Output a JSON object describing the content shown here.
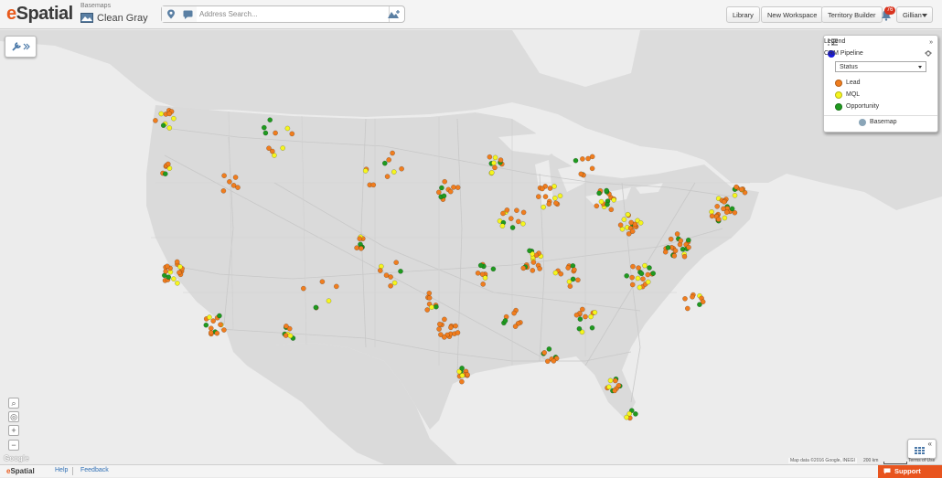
{
  "app": {
    "logo_e": "e",
    "logo_rest": "Spatial"
  },
  "basemap": {
    "caption": "Basemaps",
    "name": "Clean Gray"
  },
  "search": {
    "placeholder": "Address Search..."
  },
  "toolbar": {
    "library": "Library",
    "new_workspace": "New Workspace",
    "territory_builder": "Territory Builder",
    "notifications_count": "76",
    "user": "Gillian"
  },
  "legend": {
    "title": "Legend",
    "layer": "CRM Pipeline",
    "layer_color": "#1a1adb",
    "selected_field": "Status",
    "categories": [
      {
        "label": "Lead",
        "color": "#f07d1e"
      },
      {
        "label": "MQL",
        "color": "#f5f51e"
      },
      {
        "label": "Opportunity",
        "color": "#1f9a1f"
      }
    ],
    "basemap_link": "Basemap"
  },
  "map": {
    "watermark": "Google",
    "attribution": "Map data ©2016 Google, INEGI",
    "scale": "200 km",
    "terms": "Terms of Use"
  },
  "footer": {
    "logo_e": "e",
    "logo_rest": "Spatial",
    "help": "Help",
    "feedback": "Feedback",
    "support": "Support"
  },
  "colors": {
    "accent": "#e8541e",
    "lead": "#f07d1e",
    "mql": "#f5f51e",
    "opportunity": "#1f9a1f"
  }
}
